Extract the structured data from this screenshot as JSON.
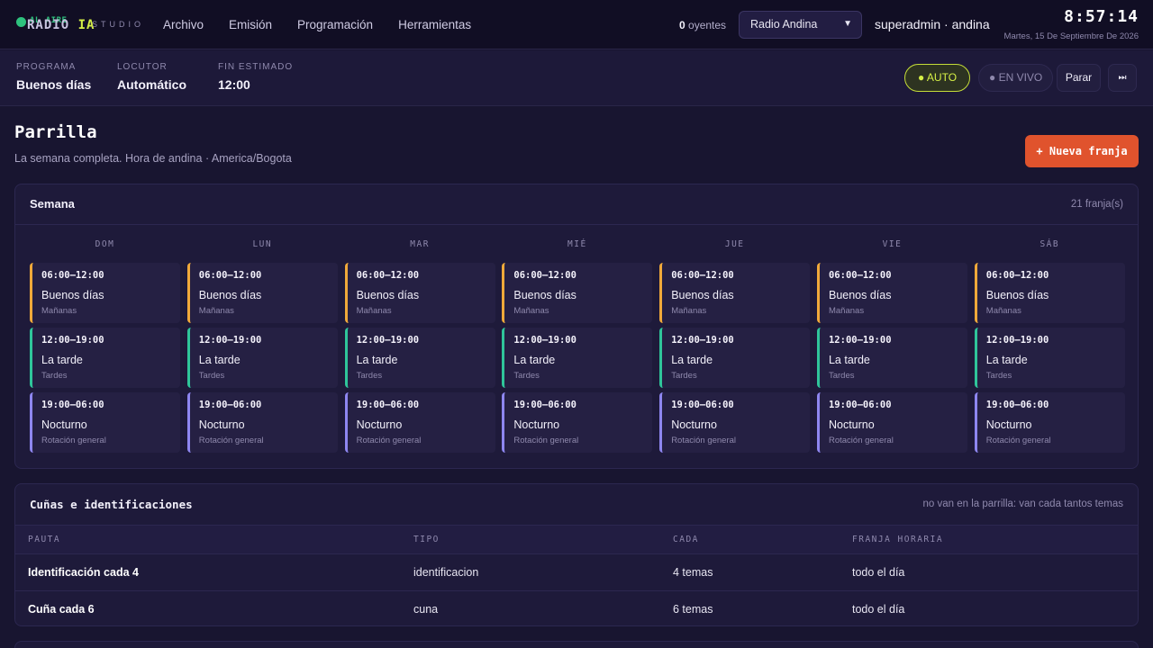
{
  "brand": {
    "onair": "AL AIRE",
    "name_prefix": "RADIO ",
    "name_suffix": "IA",
    "sub": "STUDIO"
  },
  "nav": [
    "Archivo",
    "Emisión",
    "Programación",
    "Herramientas"
  ],
  "header": {
    "listeners_count": "0",
    "listeners_label": "oyentes",
    "station": "Radio Andina",
    "user": "superadmin · andina",
    "clock": "8:57:14",
    "date": "Martes, 15 De Septiembre De 2026"
  },
  "now": {
    "program_label": "PROGRAMA",
    "program": "Buenos días",
    "host_label": "LOCUTOR",
    "host": "Automático",
    "end_label": "FIN ESTIMADO",
    "end": "12:00",
    "auto": "● AUTO",
    "live": "● EN VIVO",
    "stop": "Parar",
    "skip": "⏭"
  },
  "page": {
    "title": "Parrilla",
    "subtitle": "La semana completa. Hora de andina · America/Bogota",
    "new_button": "+ Nueva franja"
  },
  "week": {
    "title": "Semana",
    "count": "21 franja(s)",
    "days": [
      "DOM",
      "LUN",
      "MAR",
      "MIÉ",
      "JUE",
      "VIE",
      "SÁB"
    ],
    "slots": [
      {
        "time": "06:00–12:00",
        "name": "Buenos días",
        "sub": "Mañanas",
        "color": "#f0a93a"
      },
      {
        "time": "12:00–19:00",
        "name": "La tarde",
        "sub": "Tardes",
        "color": "#2fc59a"
      },
      {
        "time": "19:00–06:00",
        "name": "Nocturno",
        "sub": "Rotación general",
        "color": "#8e86f0"
      }
    ]
  },
  "ads": {
    "title": "Cuñas e identificaciones",
    "note": "no van en la parrilla: van cada tantos temas",
    "columns": [
      "PAUTA",
      "TIPO",
      "CADA",
      "FRANJA HORARIA"
    ],
    "rows": [
      [
        "Identificación cada 4",
        "identificacion",
        "4 temas",
        "todo el día"
      ],
      [
        "Cuña cada 6",
        "cuna",
        "6 temas",
        "todo el día"
      ]
    ]
  }
}
